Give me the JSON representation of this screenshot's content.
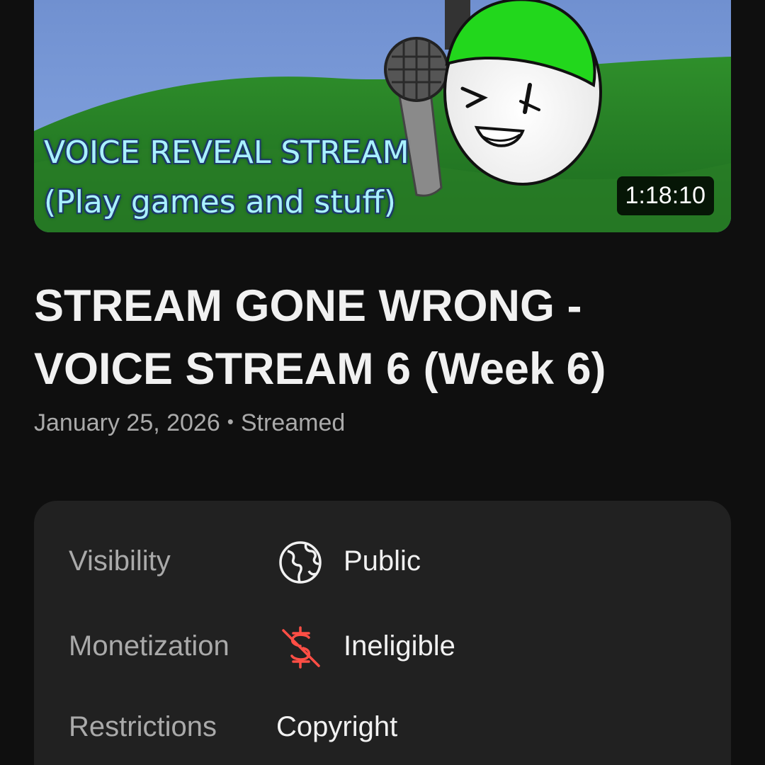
{
  "thumbnail": {
    "line1": "VOICE REVEAL STREAM",
    "line2": "(Play games and stuff)",
    "duration": "1:18:10"
  },
  "video": {
    "title": "STREAM GONE WRONG - VOICE STREAM 6 (Week 6)",
    "date": "January 25, 2026",
    "separator": "•",
    "status": "Streamed"
  },
  "details": {
    "visibility": {
      "label": "Visibility",
      "value": "Public",
      "icon": "globe-icon"
    },
    "monetization": {
      "label": "Monetization",
      "value": "Ineligible",
      "icon": "dollar-off-icon",
      "icon_color": "#ff4e45"
    },
    "restrictions": {
      "label": "Restrictions",
      "value": "Copyright"
    }
  },
  "colors": {
    "background": "#0f0f0f",
    "card": "#212121",
    "secondary_text": "#aaaaaa",
    "primary_text": "#f1f1f1"
  }
}
